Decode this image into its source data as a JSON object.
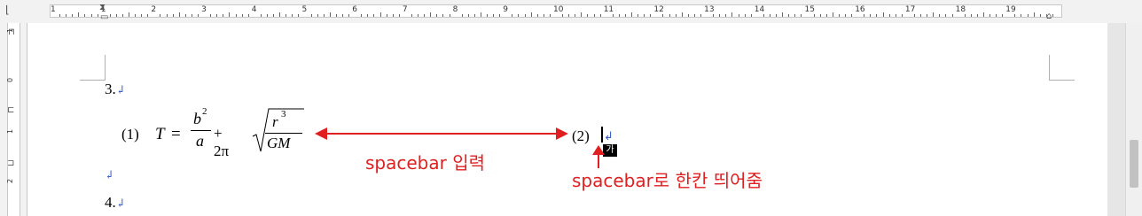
{
  "ruler": {
    "numbers": [
      "1",
      "1",
      "2",
      "3",
      "4",
      "5",
      "6",
      "7",
      "8",
      "9",
      "10",
      "11",
      "12",
      "13",
      "14",
      "15",
      "16",
      "17",
      "18",
      "19"
    ]
  },
  "vruler": {
    "numbers": [
      "1",
      "0",
      "1",
      "2"
    ]
  },
  "doc": {
    "item3": "3.",
    "item4": "4.",
    "para_mark": "↲",
    "eq_num1": "(1)",
    "eq_num2": "(2)",
    "eq": {
      "T": "T",
      "eq_sign": "=",
      "b": "b",
      "b_exp": "2",
      "a": "a",
      "plus2pi": "+ 2π",
      "r": "r",
      "r_exp": "3",
      "GM": "GM"
    }
  },
  "annotations": {
    "arrow_label": "spacebar 입력",
    "space_label": "spacebar로 한칸 띄어줌",
    "color": "#e02020"
  },
  "ime_indicator": "가"
}
